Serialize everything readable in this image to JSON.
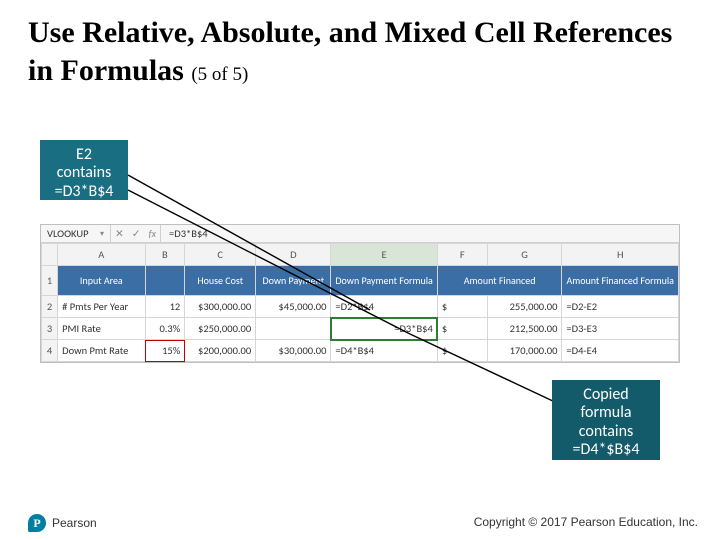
{
  "title": {
    "main": "Use Relative, Absolute, and Mixed Cell References in Formulas",
    "paren": "(5 of 5)"
  },
  "callouts": {
    "top": "E2 contains =D3*B$4",
    "bottom": "Copied formula contains =D4*$B$4"
  },
  "formula_bar": {
    "name_box": "VLOOKUP",
    "icons": {
      "x": "✕",
      "check": "✓",
      "fx": "fx"
    },
    "formula": "=D3*B$4"
  },
  "columns": [
    "",
    "A",
    "B",
    "C",
    "D",
    "E",
    "F",
    "G",
    "H"
  ],
  "header_row": {
    "rownum": "1",
    "cells": [
      "Input Area",
      "",
      "House Cost",
      "Down Payment",
      "Down Payment Formula",
      "Amount Financed",
      "",
      "Amount Financed Formula"
    ]
  },
  "rows": [
    {
      "rownum": "2",
      "cells": {
        "A": "# Pmts Per Year",
        "B": "12",
        "C": "$300,000.00",
        "D": "$45,000.00",
        "E": "=D2*B$4",
        "F": "$",
        "G": "255,000.00",
        "H": "=D2-E2"
      }
    },
    {
      "rownum": "3",
      "cells": {
        "A": "PMI Rate",
        "B": "0.3%",
        "C": "$250,000.00",
        "D": "",
        "E": "=D3*B$4",
        "F": "$",
        "G": "212,500.00",
        "H": "=D3-E3"
      },
      "selected_formula": "=D3*B$4"
    },
    {
      "rownum": "4",
      "cells": {
        "A": "Down Pmt Rate",
        "B": "15%",
        "C": "$200,000.00",
        "D": "$30,000.00",
        "E": "=D4*B$4",
        "F": "$",
        "G": "170,000.00",
        "H": "=D4-E4"
      }
    }
  ],
  "footer": {
    "copyright": "Copyright © 2017 Pearson Education, Inc.",
    "brand": "Pearson",
    "brand_letter": "P"
  }
}
